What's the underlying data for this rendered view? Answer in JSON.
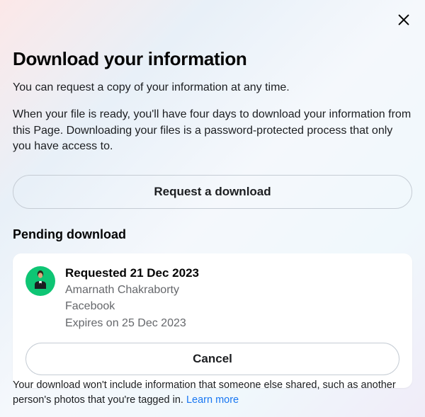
{
  "header": {
    "title": "Download your information",
    "subtitle": "You can request a copy of your information at any time.",
    "description": "When your file is ready, you'll have four days to download your information from this Page. Downloading your files is a password-protected process that only you have access to."
  },
  "buttons": {
    "request": "Request a download",
    "cancel": "Cancel"
  },
  "pending": {
    "section_title": "Pending download",
    "requested": "Requested 21 Dec 2023",
    "user": "Amarnath Chakraborty",
    "platform": "Facebook",
    "expires": "Expires on 25 Dec 2023"
  },
  "footer": {
    "text": "Your download won't include information that someone else shared, such as another person's photos that you're tagged in. ",
    "link": "Learn more"
  }
}
